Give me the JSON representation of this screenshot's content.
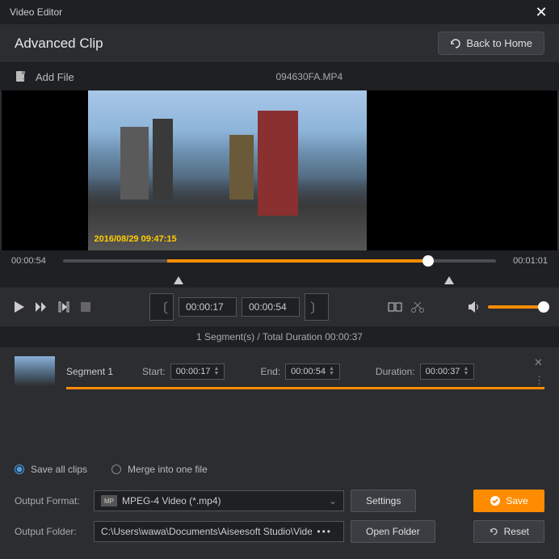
{
  "window": {
    "title": "Video Editor"
  },
  "header": {
    "title": "Advanced Clip",
    "back_label": "Back to Home"
  },
  "toolbar": {
    "add_file": "Add File",
    "filename": "094630FA.MP4"
  },
  "preview": {
    "timestamp": "2016/08/29 09:47:15"
  },
  "timeline": {
    "current": "00:00:54",
    "total": "00:01:01"
  },
  "clip": {
    "start": "00:00:17",
    "end": "00:00:54"
  },
  "segments_info": "1 Segment(s) / Total Duration 00:00:37",
  "segment": {
    "label": "Segment 1",
    "start_label": "Start:",
    "start": "00:00:17",
    "end_label": "End:",
    "end": "00:00:54",
    "duration_label": "Duration:",
    "duration": "00:00:37"
  },
  "options": {
    "save_all": "Save all clips",
    "merge": "Merge into one file"
  },
  "output": {
    "format_label": "Output Format:",
    "format_value": "MPEG-4 Video (*.mp4)",
    "settings": "Settings",
    "folder_label": "Output Folder:",
    "folder_value": "C:\\Users\\wawa\\Documents\\Aiseesoft Studio\\Video",
    "open_folder": "Open Folder",
    "save": "Save",
    "reset": "Reset"
  }
}
